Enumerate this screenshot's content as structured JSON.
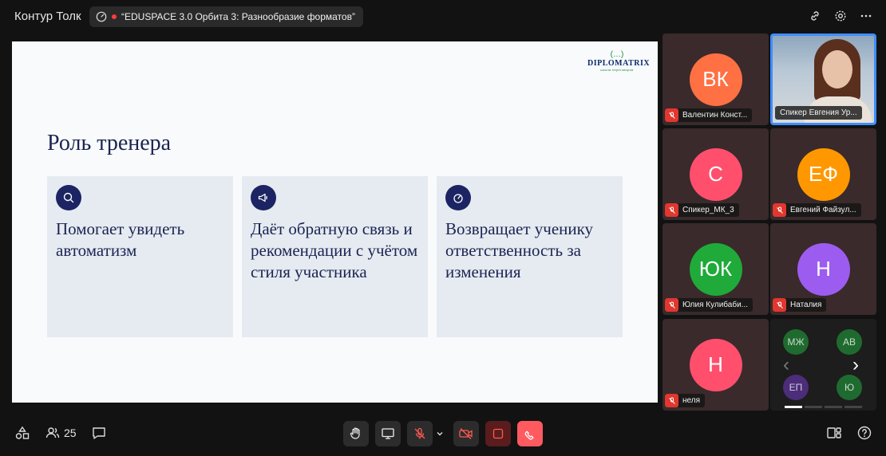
{
  "app": {
    "title": "Контур Толк"
  },
  "meeting": {
    "title": "“EDUSPACE 3.0 Орбита 3: Разнообразие форматов”"
  },
  "slide": {
    "logo": {
      "brand": "DIPLOMATRIX",
      "tagline": "школа переговоров"
    },
    "title": "Роль тренера",
    "cards": [
      {
        "icon": "search-icon",
        "text": "Помогает увидеть автоматизм"
      },
      {
        "icon": "megaphone-icon",
        "text": "Даёт обратную связь и рекомендации с учётом стиля участника"
      },
      {
        "icon": "gauge-icon",
        "text": "Возвращает ученику ответственность за изменения"
      }
    ]
  },
  "participants": [
    {
      "initials": "ВК",
      "name": "Валентин Конст...",
      "color": "#ff7043",
      "muted": true
    },
    {
      "initials": "",
      "name": "Спикер Евгения Ур...",
      "color": "#3f8dff",
      "muted": false,
      "video": true
    },
    {
      "initials": "С",
      "name": "Спикер_МК_3",
      "color": "#ff4f6d",
      "muted": true
    },
    {
      "initials": "ЕФ",
      "name": "Евгений Файзул...",
      "color": "#ff9800",
      "muted": true
    },
    {
      "initials": "ЮК",
      "name": "Юлия Кулибаби...",
      "color": "#1faa3a",
      "muted": true
    },
    {
      "initials": "Н",
      "name": "Наталия",
      "color": "#9c5cf0",
      "muted": true
    },
    {
      "initials": "Н",
      "name": "неля",
      "color": "#ff4f6d",
      "muted": true
    }
  ],
  "mini_grid": [
    {
      "initials": "МЖ",
      "color": "#1f6b2f"
    },
    {
      "initials": "АВ",
      "color": "#1f6b2f"
    },
    {
      "initials": "ЕП",
      "color": "#4b2d7a"
    },
    {
      "initials": "Ю",
      "color": "#1f6b2f"
    }
  ],
  "toolbar": {
    "participants_count": "25"
  },
  "colors": {
    "accent": "#3f8dff",
    "danger": "#e1372f",
    "slide_navy": "#1c2463"
  }
}
